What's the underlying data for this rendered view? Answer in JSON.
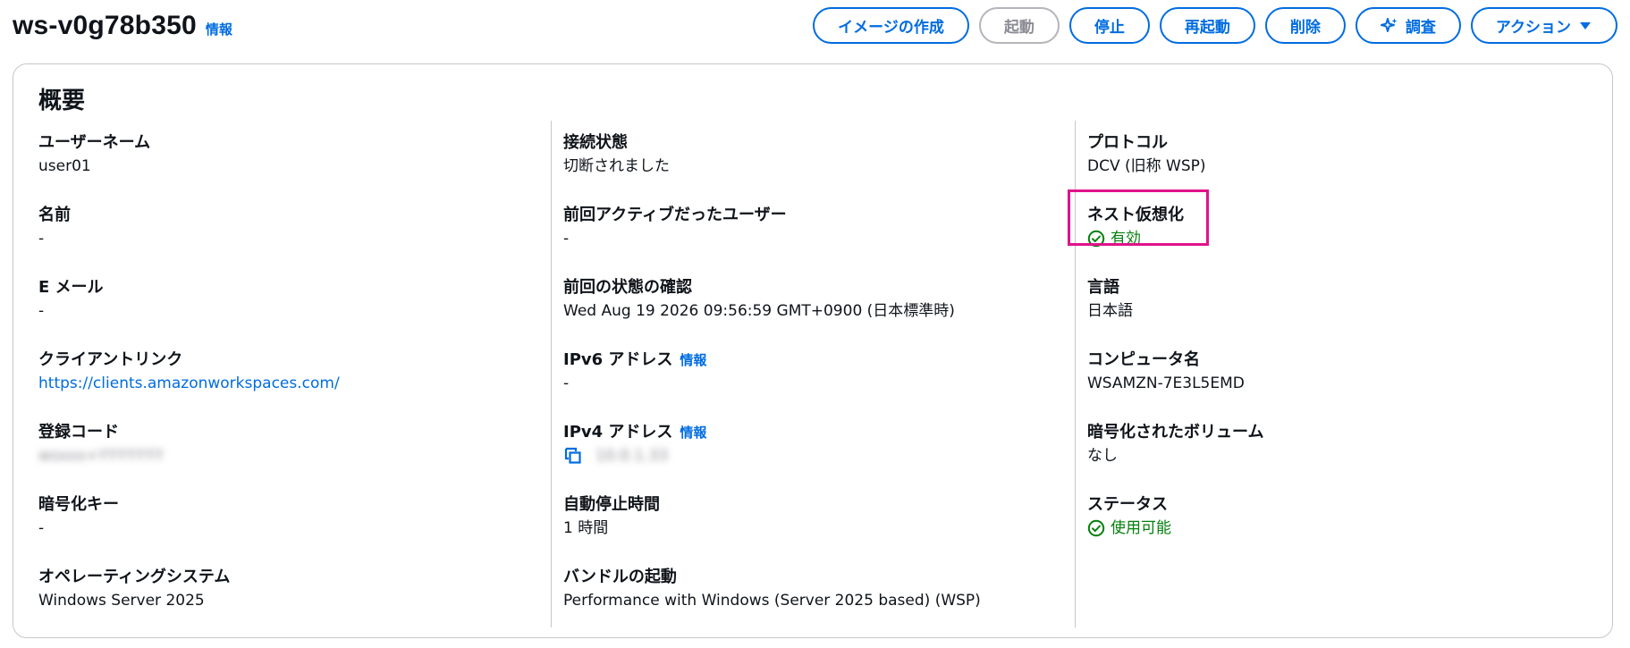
{
  "header": {
    "title": "ws-v0g78b350",
    "info_label": "情報"
  },
  "actions": {
    "create_image": "イメージの作成",
    "start": "起動",
    "stop": "停止",
    "restart": "再起動",
    "delete": "削除",
    "investigate": "調査",
    "actions": "アクション"
  },
  "summary": {
    "title": "概要",
    "col1": {
      "username_label": "ユーザーネーム",
      "username_value": "user01",
      "name_label": "名前",
      "name_value": "-",
      "email_label": "E メール",
      "email_value": "-",
      "client_link_label": "クライアントリンク",
      "client_link_value": "https://clients.amazonworkspaces.com/",
      "reg_code_label": "登録コード",
      "reg_code_value": "wsxxx+YYYYYYY",
      "enc_key_label": "暗号化キー",
      "enc_key_value": "-",
      "os_label": "オペレーティングシステム",
      "os_value": "Windows Server 2025"
    },
    "col2": {
      "conn_label": "接続状態",
      "conn_value": "切断されました",
      "last_user_label": "前回アクティブだったユーザー",
      "last_user_value": "-",
      "last_check_label": "前回の状態の確認",
      "last_check_value": "Wed Aug 19 2026 09:56:59 GMT+0900 (日本標準時)",
      "ipv6_label": "IPv6 アドレス",
      "ipv6_info": "情報",
      "ipv6_value": "-",
      "ipv4_label": "IPv4 アドレス",
      "ipv4_info": "情報",
      "ipv4_value": "10.0.1.33",
      "autostop_label": "自動停止時間",
      "autostop_value": "1 時間",
      "bundle_label": "バンドルの起動",
      "bundle_value": "Performance with Windows (Server 2025 based) (WSP)"
    },
    "col3": {
      "protocol_label": "プロトコル",
      "protocol_value": "DCV (旧称 WSP)",
      "nested_label": "ネスト仮想化",
      "nested_value": "有効",
      "language_label": "言語",
      "language_value": "日本語",
      "computer_label": "コンピュータ名",
      "computer_value": "WSAMZN-7E3L5EMD",
      "encvol_label": "暗号化されたボリューム",
      "encvol_value": "なし",
      "status_label": "ステータス",
      "status_value": "使用可能"
    }
  },
  "colors": {
    "accent": "#006ce0",
    "success": "#037f0c",
    "highlight": "#e0128a",
    "disabled": "#8c8c94"
  },
  "icons": {
    "investigate": "sparkle-icon",
    "dropdown": "caret-down-icon",
    "status": "check-circle-icon",
    "copy": "copy-icon"
  }
}
